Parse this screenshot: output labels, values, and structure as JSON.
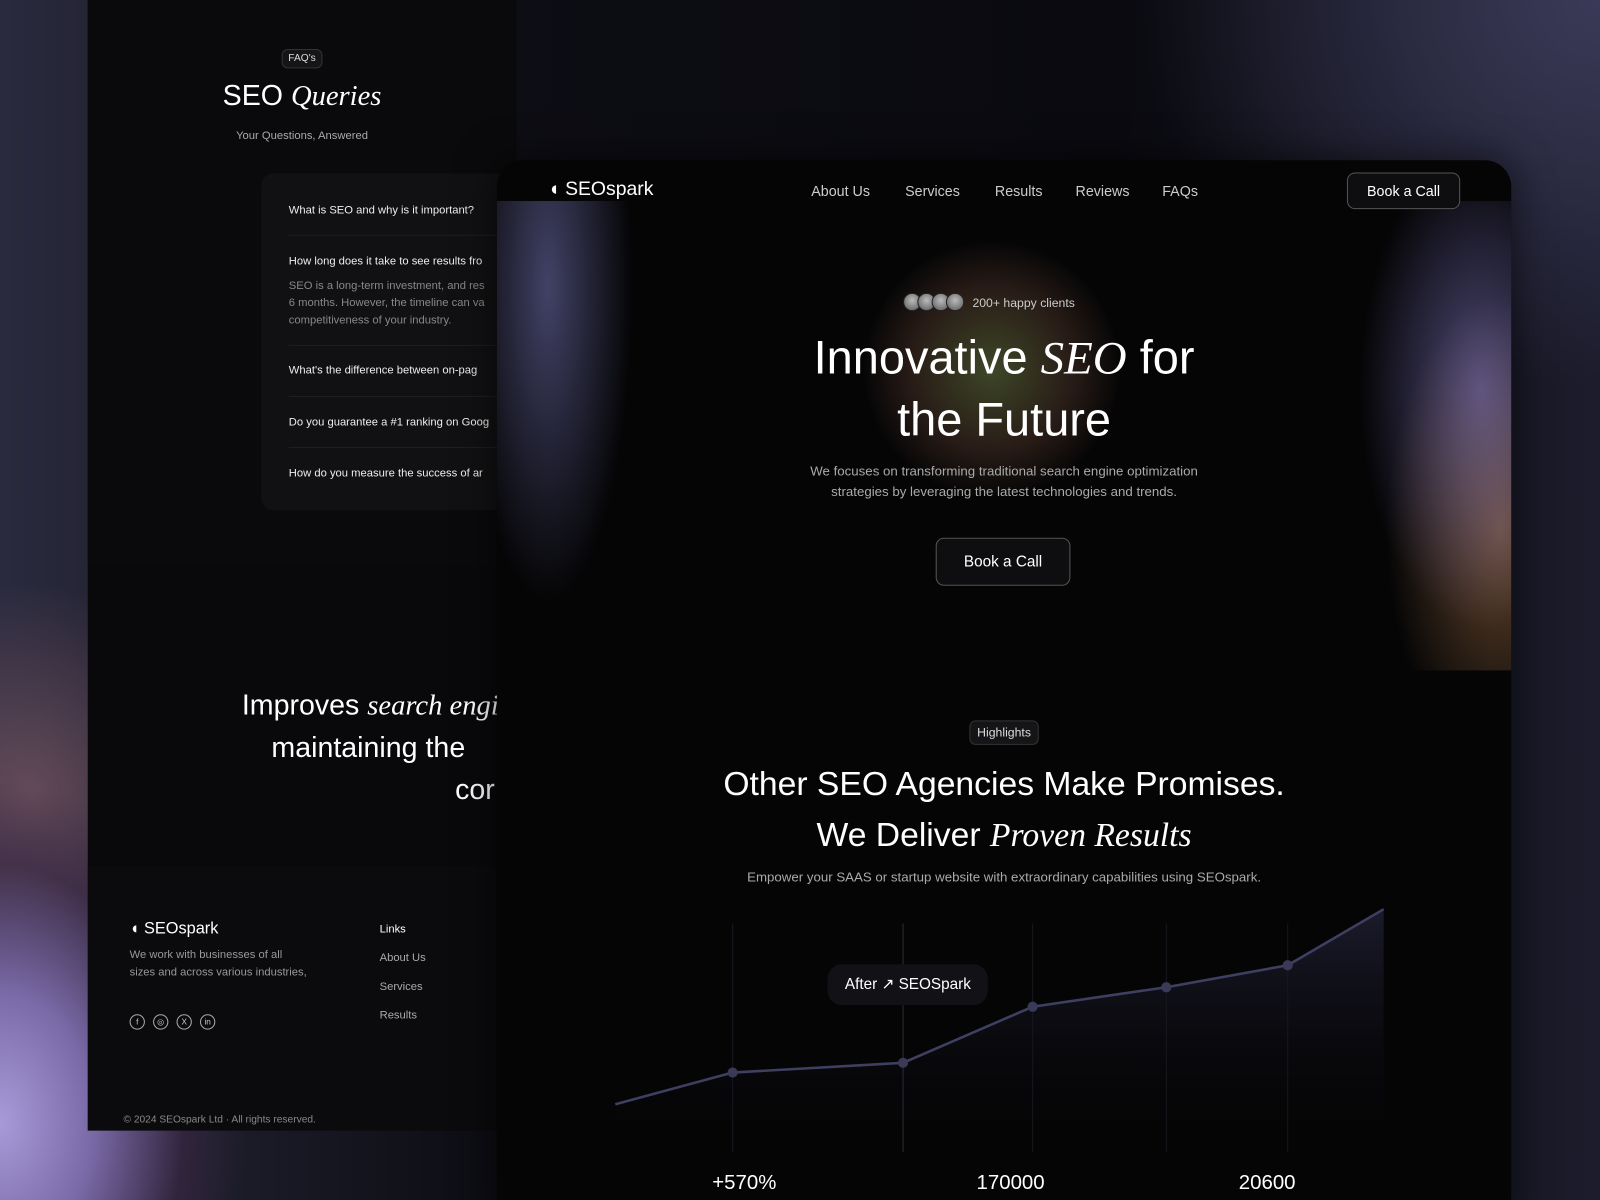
{
  "faq_page": {
    "badge": "FAQ's",
    "title_plain": "SEO",
    "title_italic": "Queries",
    "subtitle": "Your Questions, Answered",
    "questions": [
      "What is SEO and why is it important?",
      "How long does it take to see results fro",
      "What's the difference between on-pag",
      "Do you guarantee a #1 ranking on Goog",
      "How do you measure the success of ar"
    ],
    "answer_lines": [
      "SEO is a long-term investment, and res",
      "6 months. However, the timeline can va",
      "competitiveness of your industry."
    ],
    "improves": {
      "line1_plain": "Improves",
      "line1_italic": "search engin",
      "line2": "maintaining the",
      "line3": "cor"
    },
    "footer": {
      "brand": "SEOspark",
      "description": "We work with businesses of all sizes and across various industries,",
      "social_icons": [
        "facebook-icon",
        "instagram-icon",
        "x-icon",
        "linkedin-icon"
      ],
      "links_heading": "Links",
      "links": [
        "About Us",
        "Services",
        "Results"
      ],
      "copyright": "© 2024 SEOspark Ltd · All rights reserved."
    }
  },
  "nav": {
    "brand": "SEOspark",
    "items": [
      "About Us",
      "Services",
      "Results",
      "Reviews",
      "FAQs"
    ],
    "cta": "Book a Call"
  },
  "hero": {
    "clients": "200+ happy clients",
    "title_a": "Innovative",
    "title_italic": "SEO",
    "title_b": "for",
    "title_line2": "the Future",
    "description_line1": "We focuses on transforming traditional search engine optimization",
    "description_line2": "strategies by leveraging the latest technologies and trends.",
    "cta": "Book a Call"
  },
  "highlights": {
    "badge": "Highlights",
    "title_line1": "Other SEO Agencies Make Promises.",
    "title_line2_plain": "We Deliver",
    "title_line2_italic": "Proven Results",
    "subtitle": "Empower your SAAS or startup website with extraordinary capabilities using SEOspark.",
    "tooltip_before": "After",
    "tooltip_after": "SEOSpark",
    "stats": [
      "+570%",
      "170000",
      "20600"
    ]
  },
  "colors": {
    "line": "#3f3f62",
    "accent": "#8f8fd0"
  },
  "chart_data": {
    "type": "area",
    "values": [
      20,
      33,
      37,
      60,
      68,
      77,
      100
    ],
    "markers": [
      1,
      2,
      3,
      4,
      5
    ],
    "grid": "vertical lines at markers"
  }
}
